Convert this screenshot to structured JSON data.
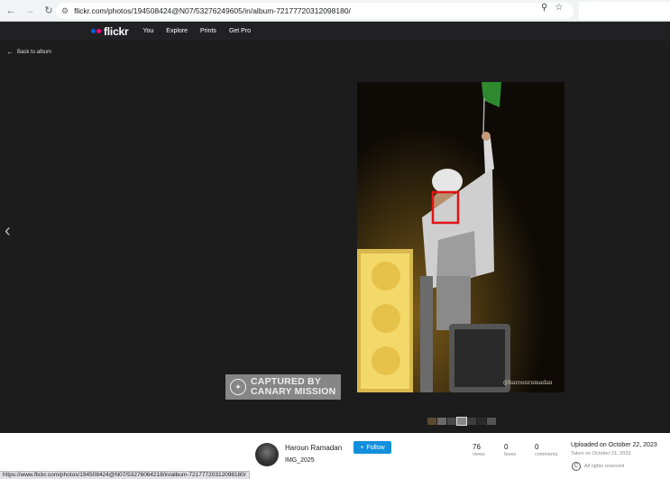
{
  "browser": {
    "url": "flickr.com/photos/194508424@N07/53276249605/in/album-72177720312098180/",
    "status_url": "https://www.flickr.com/photos/194508424@N07/53276064218/in/album-72177720312098180/"
  },
  "header": {
    "logo": "flickr",
    "nav": [
      "You",
      "Explore",
      "Prints",
      "Get Pro"
    ]
  },
  "viewer": {
    "back_label": "Back to album",
    "watermark": "@harounramadan",
    "stamp": {
      "line1": "CAPTURED BY",
      "line2": "CANARY MISSION"
    }
  },
  "info": {
    "owner": "Haroun Ramadan",
    "follow_label": "Follow",
    "title": "IMG_2025",
    "stats": [
      {
        "value": "76",
        "label": "views"
      },
      {
        "value": "0",
        "label": "faves"
      },
      {
        "value": "0",
        "label": "comments"
      }
    ],
    "uploaded": "Uploaded on October 22, 2023",
    "taken": "Taken on October 21, 2023",
    "rights": "All rights reserved"
  },
  "colors": {
    "accent_blue": "#128fdc",
    "flickr_blue": "#0063dc",
    "flickr_pink": "#ff0084",
    "highlight_box": "#e01414"
  }
}
